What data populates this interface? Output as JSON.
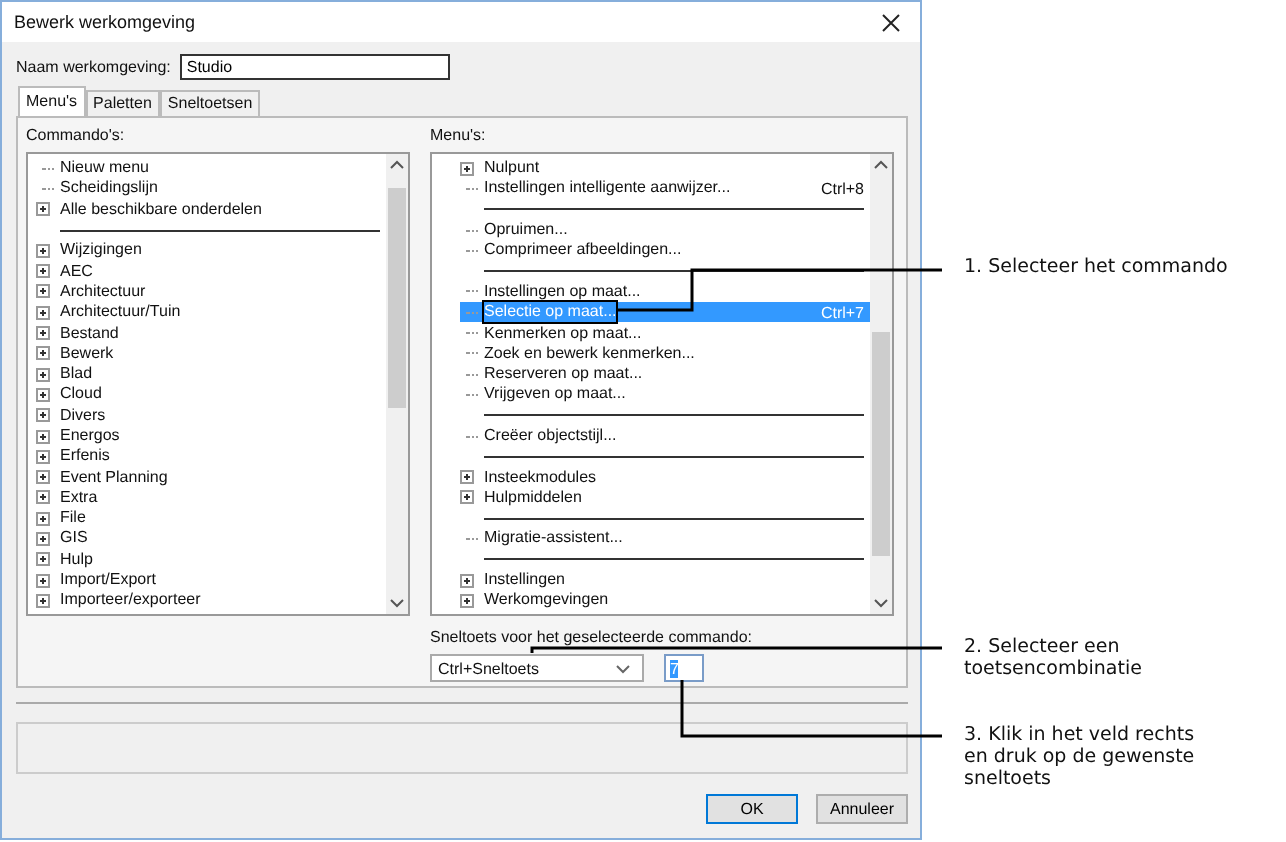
{
  "window": {
    "title": "Bewerk werkomgeving"
  },
  "name_field": {
    "label": "Naam werkomgeving:",
    "value": "Studio"
  },
  "tabs": [
    {
      "label": "Menu's",
      "selected": true
    },
    {
      "label": "Paletten",
      "selected": false
    },
    {
      "label": "Sneltoetsen",
      "selected": false
    }
  ],
  "commands": {
    "label": "Commando's:",
    "items": [
      {
        "kind": "item",
        "text": "Nieuw menu",
        "expandable": false
      },
      {
        "kind": "item",
        "text": "Scheidingslijn",
        "expandable": false
      },
      {
        "kind": "item",
        "text": "Alle beschikbare onderdelen",
        "expandable": true
      },
      {
        "kind": "separator"
      },
      {
        "kind": "item",
        "text": "Wijzigingen",
        "expandable": true
      },
      {
        "kind": "item",
        "text": "AEC",
        "expandable": true
      },
      {
        "kind": "item",
        "text": "Architectuur",
        "expandable": true
      },
      {
        "kind": "item",
        "text": "Architectuur/Tuin",
        "expandable": true
      },
      {
        "kind": "item",
        "text": "Bestand",
        "expandable": true
      },
      {
        "kind": "item",
        "text": "Bewerk",
        "expandable": true
      },
      {
        "kind": "item",
        "text": "Blad",
        "expandable": true
      },
      {
        "kind": "item",
        "text": "Cloud",
        "expandable": true
      },
      {
        "kind": "item",
        "text": "Divers",
        "expandable": true
      },
      {
        "kind": "item",
        "text": "Energos",
        "expandable": true
      },
      {
        "kind": "item",
        "text": "Erfenis",
        "expandable": true
      },
      {
        "kind": "item",
        "text": "Event Planning",
        "expandable": true
      },
      {
        "kind": "item",
        "text": "Extra",
        "expandable": true
      },
      {
        "kind": "item",
        "text": "File",
        "expandable": true
      },
      {
        "kind": "item",
        "text": "GIS",
        "expandable": true
      },
      {
        "kind": "item",
        "text": "Hulp",
        "expandable": true
      },
      {
        "kind": "item",
        "text": "Import/Export",
        "expandable": true
      },
      {
        "kind": "item",
        "text": "Importeer/exporteer",
        "expandable": true
      }
    ]
  },
  "menus": {
    "label": "Menu's:",
    "items": [
      {
        "kind": "item",
        "text": "Nulpunt",
        "expandable": true,
        "selected": false
      },
      {
        "kind": "item",
        "text": "Instellingen intelligente aanwijzer...",
        "expandable": false,
        "shortcut": "Ctrl+8",
        "selected": false
      },
      {
        "kind": "separator"
      },
      {
        "kind": "item",
        "text": "Opruimen...",
        "expandable": false,
        "selected": false
      },
      {
        "kind": "item",
        "text": "Comprimeer afbeeldingen...",
        "expandable": false,
        "selected": false
      },
      {
        "kind": "separator"
      },
      {
        "kind": "item",
        "text": "Instellingen op maat...",
        "expandable": false,
        "selected": false
      },
      {
        "kind": "item",
        "text": "Selectie op maat...",
        "expandable": false,
        "shortcut": "Ctrl+7",
        "selected": true
      },
      {
        "kind": "item",
        "text": "Kenmerken op maat...",
        "expandable": false,
        "selected": false
      },
      {
        "kind": "item",
        "text": "Zoek en bewerk kenmerken...",
        "expandable": false,
        "selected": false
      },
      {
        "kind": "item",
        "text": "Reserveren op maat...",
        "expandable": false,
        "selected": false
      },
      {
        "kind": "item",
        "text": "Vrijgeven op maat...",
        "expandable": false,
        "selected": false
      },
      {
        "kind": "separator"
      },
      {
        "kind": "item",
        "text": "Creëer objectstijl...",
        "expandable": false,
        "selected": false
      },
      {
        "kind": "separator"
      },
      {
        "kind": "item",
        "text": "Insteekmodules",
        "expandable": true,
        "selected": false
      },
      {
        "kind": "item",
        "text": "Hulpmiddelen",
        "expandable": true,
        "selected": false
      },
      {
        "kind": "separator"
      },
      {
        "kind": "item",
        "text": "Migratie-assistent...",
        "expandable": false,
        "selected": false
      },
      {
        "kind": "separator"
      },
      {
        "kind": "item",
        "text": "Instellingen",
        "expandable": true,
        "selected": false
      },
      {
        "kind": "item",
        "text": "Werkomgevingen",
        "expandable": true,
        "selected": false
      }
    ]
  },
  "shortcut": {
    "label": "Sneltoets voor het geselecteerde commando:",
    "modifier": "Ctrl+Sneltoets",
    "key": "7"
  },
  "buttons": [
    "OK",
    "Annuleer"
  ],
  "callouts": [
    "1. Selecteer het commando",
    "2. Selecteer een toetsencombinatie",
    "3. Klik in het veld rechts en druk op de gewenste sneltoets"
  ]
}
